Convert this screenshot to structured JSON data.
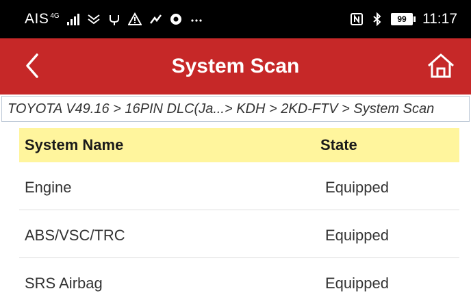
{
  "status_bar": {
    "carrier": "AIS",
    "network_badge": "4G",
    "battery_level": "99",
    "time": "11:17",
    "icons": [
      "signal-icon",
      "chat-icon",
      "usb-icon",
      "warning-icon",
      "hands-free-icon",
      "chrome-icon",
      "more-icon",
      "nfc-icon",
      "bluetooth-icon",
      "battery-icon"
    ]
  },
  "app_bar": {
    "title": "System Scan",
    "background_color": "#c62828",
    "left_icon": "back-chevron-icon",
    "right_icon": "home-icon"
  },
  "breadcrumb": {
    "text": "TOYOTA V49.16 > 16PIN DLC(Ja...> KDH > 2KD-FTV > System Scan"
  },
  "table": {
    "header_color": "#fff59d",
    "columns": [
      "System Name",
      "State"
    ],
    "rows": [
      {
        "name": "Engine",
        "state": "Equipped"
      },
      {
        "name": "ABS/VSC/TRC",
        "state": "Equipped"
      },
      {
        "name": "SRS Airbag",
        "state": "Equipped"
      }
    ]
  }
}
